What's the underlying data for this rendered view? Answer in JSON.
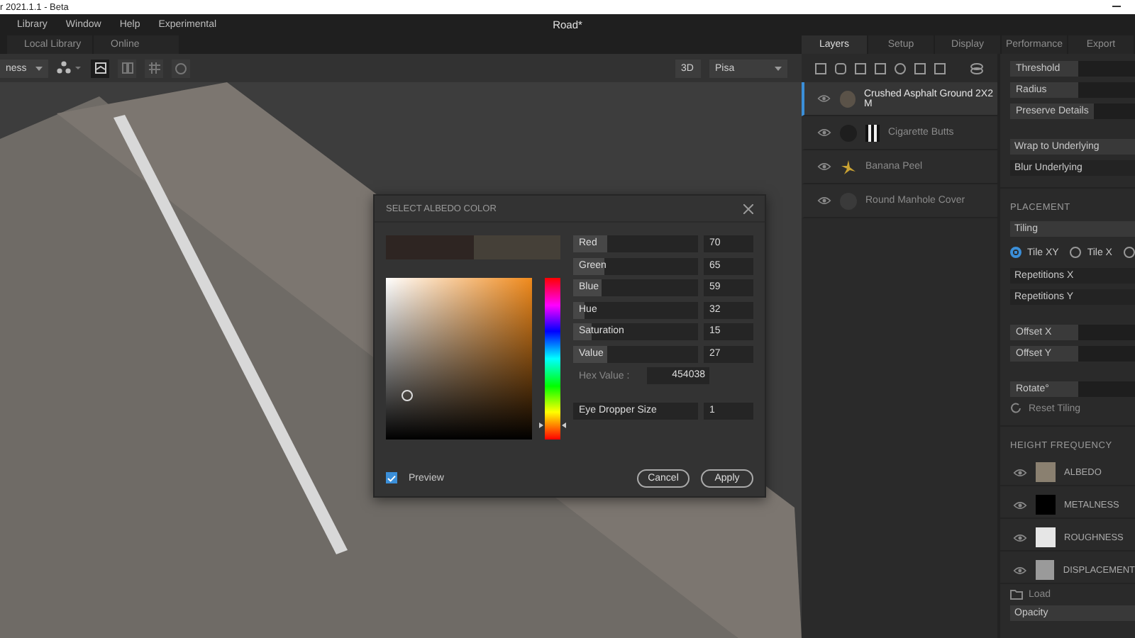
{
  "window": {
    "title": "r 2021.1.1 - Beta"
  },
  "menu": [
    "Library",
    "Window",
    "Help",
    "Experimental"
  ],
  "document_title": "Road*",
  "library_tabs": [
    {
      "label": "Local Library",
      "selected": false
    },
    {
      "label": "Online",
      "selected": false
    }
  ],
  "toolbar": {
    "channel_dropdown": "ness",
    "view_dropdown": "3D",
    "environment_dropdown": "Pisa"
  },
  "panel_tabs": [
    {
      "label": "Layers",
      "selected": true
    },
    {
      "label": "Setup",
      "selected": false
    },
    {
      "label": "Display",
      "selected": false
    },
    {
      "label": "Performance",
      "selected": false
    },
    {
      "label": "Export",
      "selected": false
    }
  ],
  "layers": [
    {
      "name": "Crushed Asphalt Ground 2X2 M",
      "selected": true,
      "kind": "sphere",
      "color": "#5a5248"
    },
    {
      "name": "Cigarette Butts",
      "selected": false,
      "kind": "sphere-mask",
      "color": "#1e1e1e"
    },
    {
      "name": "Banana Peel",
      "selected": false,
      "kind": "decal",
      "color": "#c9a233"
    },
    {
      "name": "Round Manhole Cover",
      "selected": false,
      "kind": "sphere",
      "color": "#3a3a3a"
    }
  ],
  "properties": {
    "fields": [
      "Threshold",
      "Radius",
      "Preserve Details"
    ],
    "blend_fields": [
      "Wrap to Underlying",
      "Blur Underlying"
    ],
    "placement": {
      "heading": "PLACEMENT",
      "mode": "Tiling",
      "radios": [
        {
          "label": "Tile XY",
          "selected": true
        },
        {
          "label": "Tile X",
          "selected": false
        },
        {
          "selected": false
        }
      ],
      "repetitions": [
        "Repetitions X",
        "Repetitions Y"
      ],
      "offsets": [
        "Offset X",
        "Offset Y"
      ],
      "rotate": "Rotate°",
      "reset": "Reset Tiling"
    },
    "height_frequency": {
      "heading": "HEIGHT FREQUENCY",
      "channels": [
        {
          "name": "ALBEDO",
          "color": "#8a8070"
        },
        {
          "name": "METALNESS",
          "color": "#000000"
        },
        {
          "name": "ROUGHNESS",
          "color": "#e6e6e6"
        },
        {
          "name": "DISPLACEMENT",
          "color": "#9a9a9a"
        }
      ]
    },
    "load": "Load",
    "opacity": "Opacity"
  },
  "dialog": {
    "title": "SELECT ALBEDO COLOR",
    "hue_bar": {
      "level": 0.09
    },
    "sliders": [
      {
        "label": "Red",
        "value": "70",
        "level": 0.27
      },
      {
        "label": "Green",
        "value": "65",
        "level": 0.25
      },
      {
        "label": "Blue",
        "value": "59",
        "level": 0.23
      },
      {
        "label": "Hue",
        "value": "32",
        "level": 0.09
      },
      {
        "label": "Saturation",
        "value": "15",
        "level": 0.15
      },
      {
        "label": "Value",
        "value": "27",
        "level": 0.27
      }
    ],
    "hex_label": "Hex Value :",
    "hex_value": "454038",
    "eye_dropper": {
      "label": "Eye Dropper Size",
      "value": "1"
    },
    "preview": {
      "label": "Preview",
      "checked": true
    },
    "buttons": [
      "Cancel",
      "Apply"
    ]
  }
}
